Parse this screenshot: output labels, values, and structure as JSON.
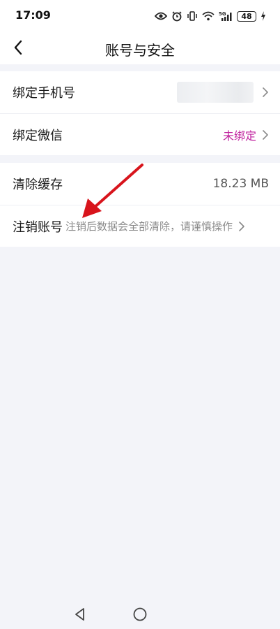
{
  "status_bar": {
    "time": "17:09",
    "network": "5G",
    "battery": "48"
  },
  "header": {
    "title": "账号与安全"
  },
  "groups": [
    {
      "items": [
        {
          "label": "绑定手机号",
          "value": ""
        },
        {
          "label": "绑定微信",
          "value": "未绑定"
        }
      ]
    },
    {
      "items": [
        {
          "label": "清除缓存",
          "value": "18.23 MB"
        },
        {
          "label": "注销账号",
          "value": "注销后数据会全部清除，请谨慎操作"
        }
      ]
    }
  ],
  "icons": {
    "back": "back-chevron-icon",
    "row_arrow": "chevron-right-icon",
    "nav_back": "nav-back-triangle-icon",
    "nav_home": "nav-home-circle-icon"
  },
  "colors": {
    "accent_unbound": "#c0249f",
    "background": "#f3f4f9",
    "annotation_arrow": "#d8141c"
  }
}
